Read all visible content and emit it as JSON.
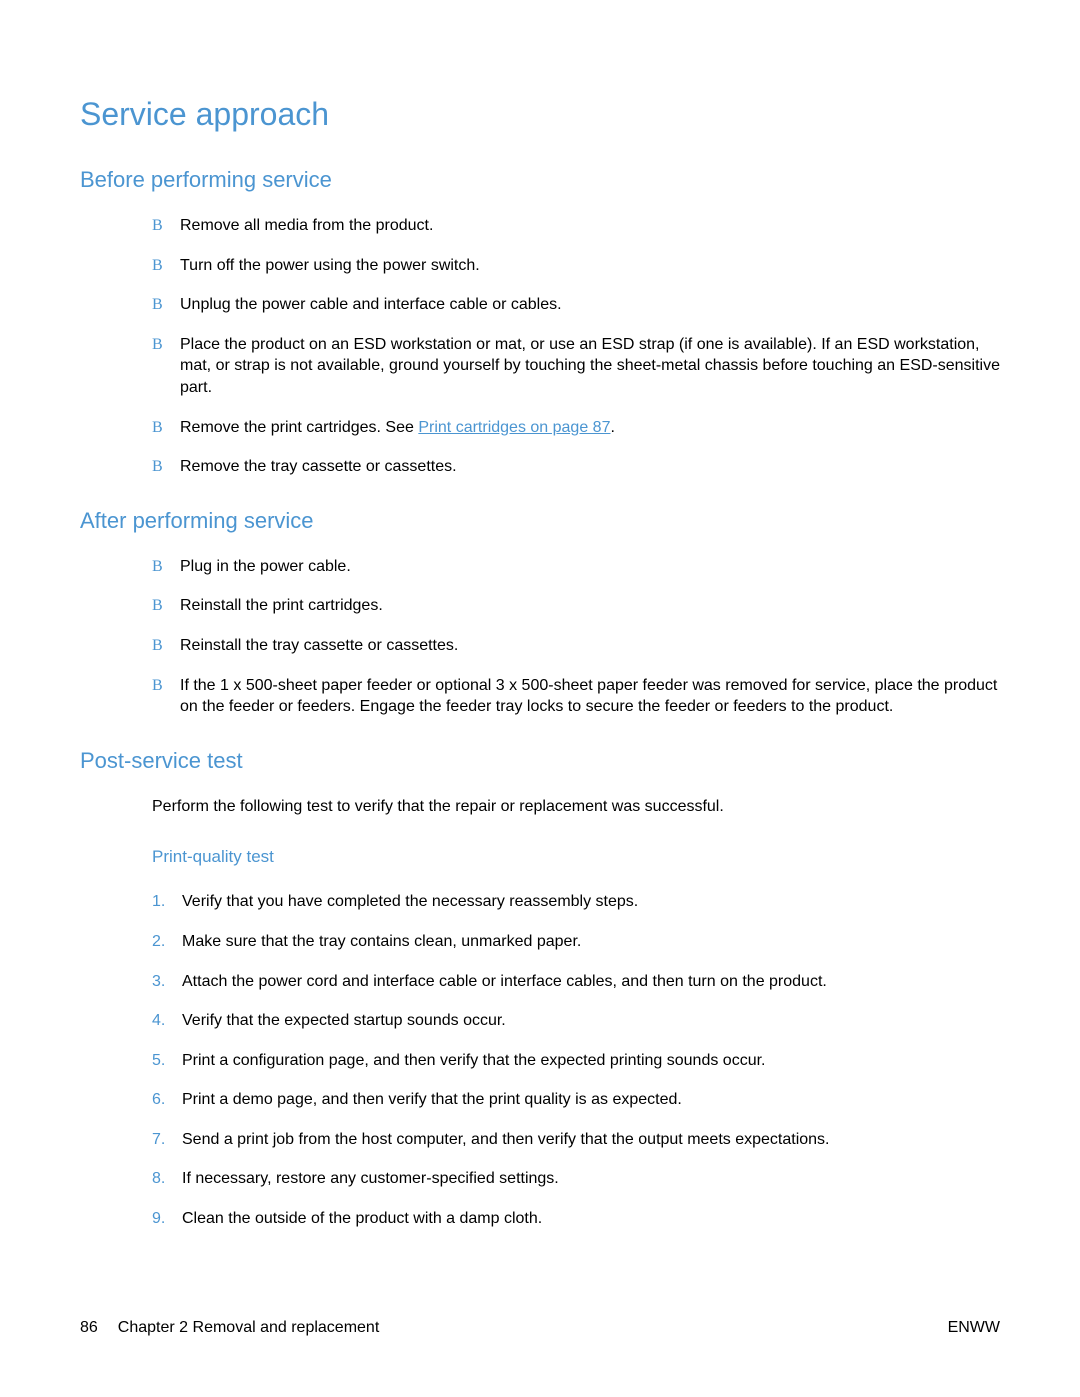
{
  "title": "Service approach",
  "sections": {
    "before": {
      "heading": "Before performing service",
      "items": [
        "Remove all media from the product.",
        "Turn off the power using the power switch.",
        "Unplug the power cable and interface cable or cables.",
        "Place the product on an ESD workstation or mat, or use an ESD strap (if one is available). If an ESD workstation, mat, or strap is not available, ground yourself by touching the sheet-metal chassis before touching an ESD-sensitive part.",
        "__LINK_ITEM__",
        "Remove the tray cassette or cassettes."
      ],
      "link_item_prefix": "Remove the print cartridges. See ",
      "link_item_link": "Print cartridges on page 87",
      "link_item_suffix": "."
    },
    "after": {
      "heading": "After performing service",
      "items": [
        "Plug in the power cable.",
        "Reinstall the print cartridges.",
        "Reinstall the tray cassette or cassettes.",
        "If the 1 x 500-sheet paper feeder or optional 3 x 500-sheet paper feeder was removed for service, place the product on the feeder or feeders. Engage the feeder tray locks to secure the feeder or feeders to the product."
      ]
    },
    "post": {
      "heading": "Post-service test",
      "intro": "Perform the following test to verify that the repair or replacement was successful.",
      "sub_heading": "Print-quality test",
      "steps": [
        "Verify that you have completed the necessary reassembly steps.",
        "Make sure that the tray contains clean, unmarked paper.",
        "Attach the power cord and interface cable or interface cables, and then turn on the product.",
        "Verify that the expected startup sounds occur.",
        "Print a configuration page, and then verify that the expected printing sounds occur.",
        "Print a demo page, and then verify that the print quality is as expected.",
        "Send a print job from the host computer, and then verify that the output meets expectations.",
        "If necessary, restore any customer-specified settings.",
        "Clean the outside of the product with a damp cloth."
      ]
    }
  },
  "bullet_glyph": "B",
  "footer": {
    "page_number": "86",
    "chapter": "Chapter 2   Removal and replacement",
    "right": "ENWW"
  }
}
